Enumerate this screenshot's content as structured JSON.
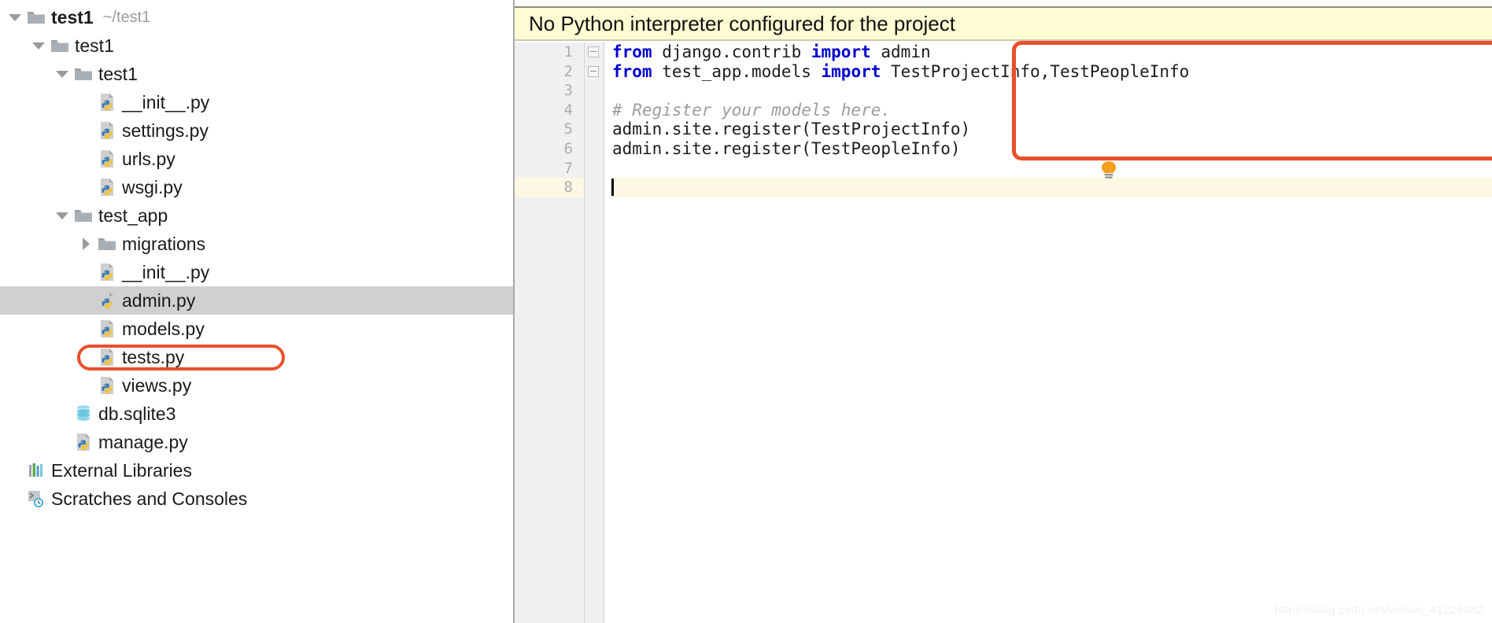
{
  "colors": {
    "annotation": "#e8502a",
    "banner_bg": "#fdfcd3",
    "selection_bg": "#d0d0d0",
    "current_line_bg": "#fdf8e3",
    "keyword": "#0000cf",
    "comment": "#9d9d9d",
    "gutter_bg": "#f0f0f0"
  },
  "sidebar": {
    "name": "project-tool-window",
    "items": [
      {
        "label": "test1",
        "path_hint": "~/test1",
        "icon": "folder-icon",
        "indent": 0,
        "arrow": "chevron-down-icon",
        "bold": true,
        "selected": false
      },
      {
        "label": "test1",
        "path_hint": "",
        "icon": "folder-icon",
        "indent": 1,
        "arrow": "chevron-down-icon",
        "bold": false,
        "selected": false
      },
      {
        "label": "test1",
        "path_hint": "",
        "icon": "folder-icon",
        "indent": 2,
        "arrow": "chevron-down-icon",
        "bold": false,
        "selected": false
      },
      {
        "label": "__init__.py",
        "path_hint": "",
        "icon": "python-file-icon",
        "indent": 3,
        "arrow": "none",
        "bold": false,
        "selected": false
      },
      {
        "label": "settings.py",
        "path_hint": "",
        "icon": "python-file-icon",
        "indent": 3,
        "arrow": "none",
        "bold": false,
        "selected": false
      },
      {
        "label": "urls.py",
        "path_hint": "",
        "icon": "python-file-icon",
        "indent": 3,
        "arrow": "none",
        "bold": false,
        "selected": false
      },
      {
        "label": "wsgi.py",
        "path_hint": "",
        "icon": "python-file-icon",
        "indent": 3,
        "arrow": "none",
        "bold": false,
        "selected": false
      },
      {
        "label": "test_app",
        "path_hint": "",
        "icon": "folder-icon",
        "indent": 2,
        "arrow": "chevron-down-icon",
        "bold": false,
        "selected": false
      },
      {
        "label": "migrations",
        "path_hint": "",
        "icon": "folder-icon",
        "indent": 3,
        "arrow": "chevron-right-icon",
        "bold": false,
        "selected": false
      },
      {
        "label": "__init__.py",
        "path_hint": "",
        "icon": "python-file-icon",
        "indent": 3,
        "arrow": "none",
        "bold": false,
        "selected": false
      },
      {
        "label": "admin.py",
        "path_hint": "",
        "icon": "python-file-icon",
        "indent": 3,
        "arrow": "none",
        "bold": false,
        "selected": true
      },
      {
        "label": "models.py",
        "path_hint": "",
        "icon": "python-file-icon",
        "indent": 3,
        "arrow": "none",
        "bold": false,
        "selected": false
      },
      {
        "label": "tests.py",
        "path_hint": "",
        "icon": "python-file-icon",
        "indent": 3,
        "arrow": "none",
        "bold": false,
        "selected": false
      },
      {
        "label": "views.py",
        "path_hint": "",
        "icon": "python-file-icon",
        "indent": 3,
        "arrow": "none",
        "bold": false,
        "selected": false
      },
      {
        "label": "db.sqlite3",
        "path_hint": "",
        "icon": "database-icon",
        "indent": 2,
        "arrow": "none",
        "bold": false,
        "selected": false
      },
      {
        "label": "manage.py",
        "path_hint": "",
        "icon": "python-file-icon",
        "indent": 2,
        "arrow": "none",
        "bold": false,
        "selected": false
      },
      {
        "label": "External Libraries",
        "path_hint": "",
        "icon": "libraries-icon",
        "indent": 0,
        "arrow": "none",
        "bold": false,
        "selected": false
      },
      {
        "label": "Scratches and Consoles",
        "path_hint": "",
        "icon": "scratches-icon",
        "indent": 0,
        "arrow": "none",
        "bold": false,
        "selected": false
      }
    ]
  },
  "editor": {
    "banner": {
      "name": "no-interpreter-banner",
      "text": "No Python interpreter configured for the project"
    },
    "gutter": {
      "line_numbers": [
        "1",
        "2",
        "3",
        "4",
        "5",
        "6",
        "7",
        "8"
      ],
      "current_line": 8
    },
    "code_lines": [
      {
        "number": "1",
        "fold": true,
        "tokens": [
          {
            "t": "from ",
            "c": "kw"
          },
          {
            "t": "django.contrib ",
            "c": ""
          },
          {
            "t": "import ",
            "c": "kw"
          },
          {
            "t": "admin",
            "c": ""
          }
        ]
      },
      {
        "number": "2",
        "fold": true,
        "tokens": [
          {
            "t": "from ",
            "c": "kw"
          },
          {
            "t": "test_app.models ",
            "c": ""
          },
          {
            "t": "import ",
            "c": "kw"
          },
          {
            "t": "TestProjectInfo,TestPeopleInfo",
            "c": ""
          }
        ]
      },
      {
        "number": "3",
        "fold": false,
        "tokens": [
          {
            "t": "",
            "c": ""
          }
        ]
      },
      {
        "number": "4",
        "fold": false,
        "tokens": [
          {
            "t": "# Register your models here.",
            "c": "cm"
          }
        ]
      },
      {
        "number": "5",
        "fold": false,
        "tokens": [
          {
            "t": "admin.site.register(TestProjectInfo)",
            "c": ""
          }
        ]
      },
      {
        "number": "6",
        "fold": false,
        "tokens": [
          {
            "t": "admin.site.register(TestPeopleInfo)",
            "c": ""
          }
        ]
      },
      {
        "number": "7",
        "fold": false,
        "tokens": [
          {
            "t": "",
            "c": ""
          }
        ]
      },
      {
        "number": "8",
        "fold": false,
        "current": true,
        "caret": true,
        "tokens": [
          {
            "t": "",
            "c": ""
          }
        ]
      }
    ],
    "intention_bulb": "lightbulb-icon",
    "annotations": [
      {
        "name": "code-annotation-rect",
        "target": "import-and-register-block"
      },
      {
        "name": "admin-file-annotation-rect",
        "target": "admin.py"
      }
    ]
  },
  "watermark": {
    "text": "https://blog.csdn.net/weixin_41229982"
  }
}
